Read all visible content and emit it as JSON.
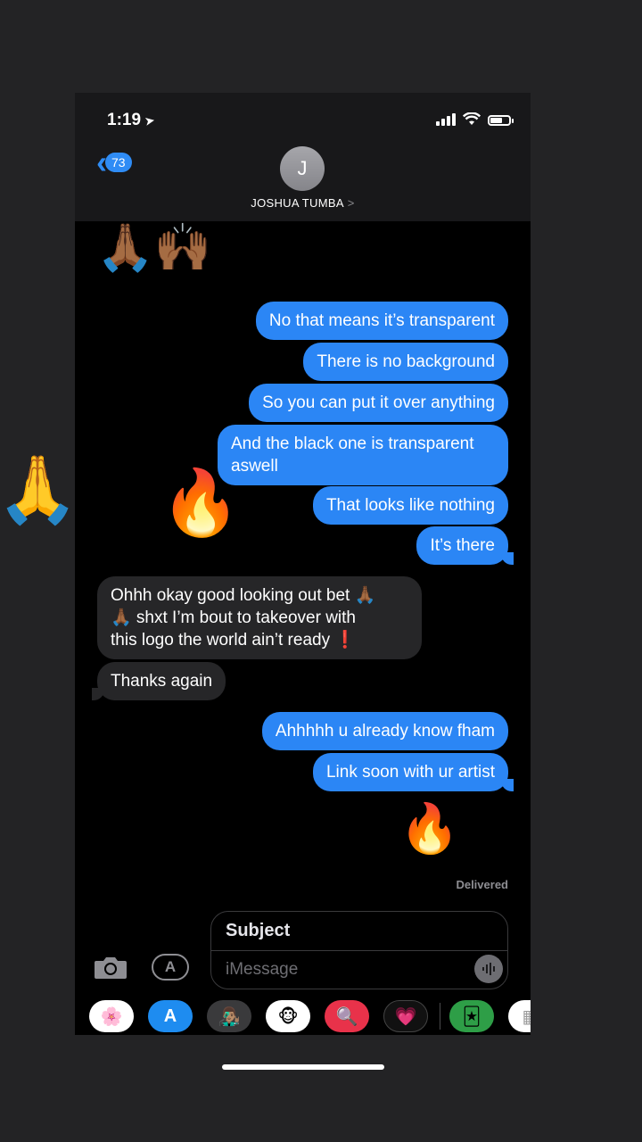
{
  "status": {
    "time": "1:19",
    "location_arrow": "➤"
  },
  "header": {
    "back_count": "73",
    "avatar_initial": "J",
    "contact_name": "JOSHUA TUMBA",
    "chevron": ">"
  },
  "messages": {
    "top_emoji": "🙏🏾🙌🏾",
    "out1": "No that means it’s transparent",
    "out2": "There is no background",
    "out3": "So you can put it over anything",
    "out4_line1": "And the black one is transparent",
    "out4_line2": "aswell",
    "sticker_devil": "😈",
    "sticker_fire": "🔥",
    "out5": "That looks like nothing",
    "out6": "It’s there",
    "in1_line1": "Ohhh okay good looking out bet 🙏🏾",
    "in1_line2": "🙏🏾 shxt I’m bout to takeover with",
    "in1_line3": "this logo the world ain’t ready ❗",
    "in2": "Thanks again",
    "out7": "Ahhhhh u already know fham",
    "out8": "Link soon with ur artist",
    "bottom_emoji_fire": "🔥",
    "bottom_emoji_devil": "😈",
    "delivered": "Delivered"
  },
  "composer": {
    "subject_placeholder": "Subject",
    "message_placeholder": "iMessage"
  },
  "side_sticker": "🙏",
  "appbar": {
    "photos": "🌸",
    "appstore": "A",
    "memoji": "👨🏽‍🎤",
    "animoji": "🐵",
    "search": "🔍",
    "digital_touch": "💗",
    "games": "🃏",
    "more": "▦"
  },
  "colors": {
    "outgoing": "#2b86f5",
    "incoming": "#262628",
    "accent": "#2f8cf5"
  }
}
